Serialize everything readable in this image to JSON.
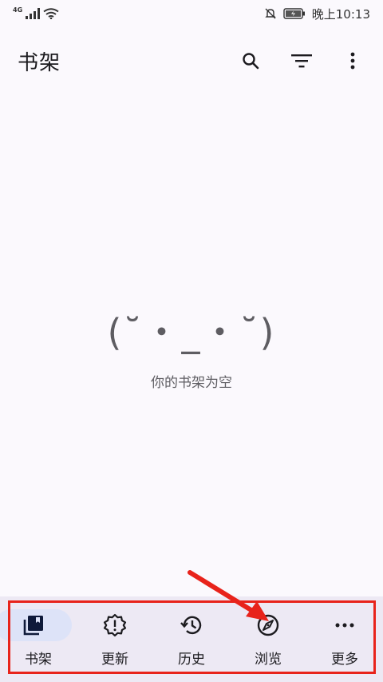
{
  "status_bar": {
    "network": "4G",
    "time": "晚上10:13"
  },
  "app_bar": {
    "title": "书架",
    "actions": [
      "search-icon",
      "filter-icon",
      "more-vert-icon"
    ]
  },
  "empty_state": {
    "kaomoji": "(˘・_・˘)",
    "message": "你的书架为空"
  },
  "bottom_nav": {
    "items": [
      {
        "label": "书架",
        "icon": "library-icon",
        "active": true
      },
      {
        "label": "更新",
        "icon": "update-badge-icon",
        "active": false
      },
      {
        "label": "历史",
        "icon": "history-icon",
        "active": false
      },
      {
        "label": "浏览",
        "icon": "compass-icon",
        "active": false
      },
      {
        "label": "更多",
        "icon": "more-horiz-icon",
        "active": false
      }
    ]
  },
  "colors": {
    "background": "#fbf9fd",
    "nav_background": "#ede9f4",
    "active_pill": "#dde3f8",
    "annotation_red": "#e8231b"
  }
}
